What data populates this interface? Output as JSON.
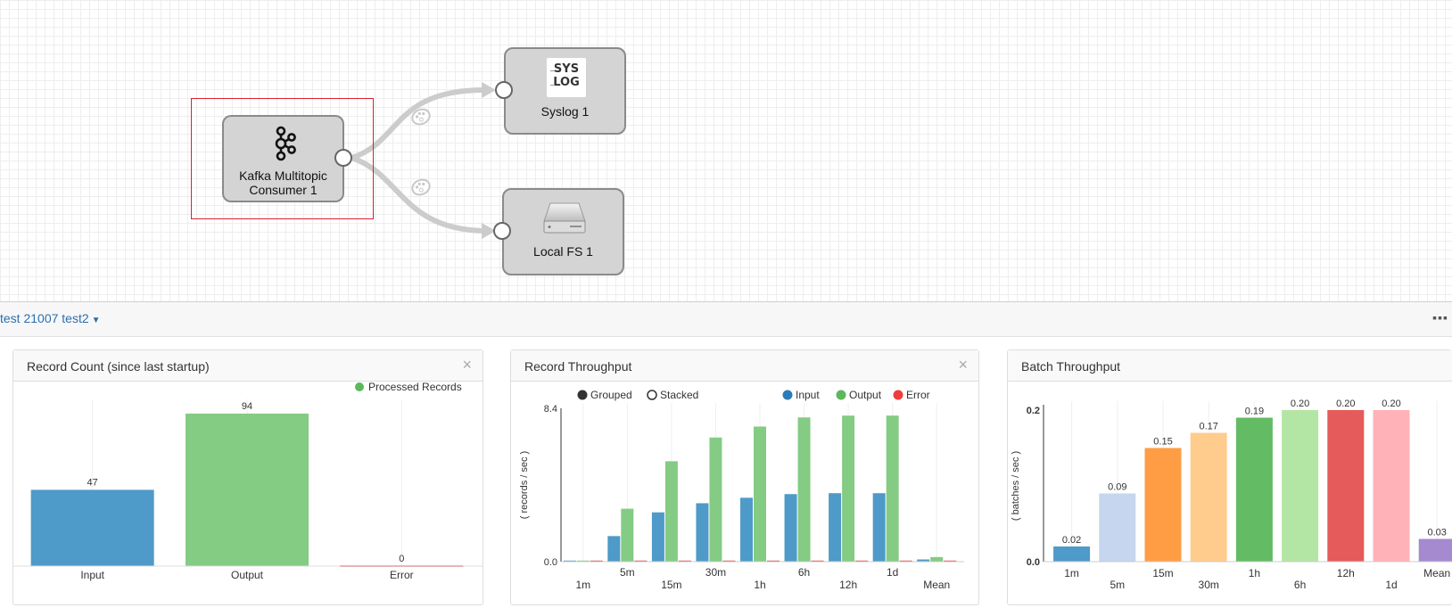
{
  "canvas": {
    "stages": [
      {
        "id": "kafka",
        "label_line1": "Kafka Multitopic",
        "label_line2": "Consumer 1",
        "icon": "kafka-icon"
      },
      {
        "id": "syslog",
        "label_line1": "Syslog 1",
        "icon": "syslog-icon",
        "icon_text_top": "SYS",
        "icon_text_bottom": "LOG"
      },
      {
        "id": "localfs",
        "label_line1": "Local FS 1",
        "icon": "hard-drive-icon"
      }
    ],
    "edge_icon": "palette-icon",
    "selection_color": "#d9232d"
  },
  "panel_bar": {
    "pipeline_dropdown": "test 21007 test2",
    "more_icon": "ellipsis-icon",
    "more_label": "▪▪▪"
  },
  "widgets": {
    "record_count": {
      "title": "Record Count (since last startup)",
      "close_label": "×"
    },
    "record_throughput": {
      "title": "Record Throughput",
      "close_label": "×",
      "toggle_grouped": "Grouped",
      "toggle_stacked": "Stacked"
    },
    "batch_throughput": {
      "title": "Batch Throughput"
    }
  },
  "chart_data": [
    {
      "type": "bar",
      "chart": "record_count",
      "categories": [
        "Input",
        "Output",
        "Error"
      ],
      "values": [
        47,
        94,
        0
      ],
      "value_labels": [
        "47",
        "94",
        "0"
      ],
      "legend": [
        "Processed Records"
      ],
      "legend_color": "#5cb85c",
      "colors": [
        "#4e9ac8",
        "#84cb84",
        "#f28a8a"
      ],
      "ylim": [
        0,
        100
      ]
    },
    {
      "type": "bar",
      "chart": "record_throughput",
      "categories": [
        "1m",
        "5m",
        "15m",
        "30m",
        "1h",
        "6h",
        "12h",
        "1d",
        "Mean"
      ],
      "ylabel": "( records / sec )",
      "ytick_labels": [
        "8.4",
        "0.0"
      ],
      "ylim": [
        0,
        8.4
      ],
      "series": [
        {
          "name": "Input",
          "color": "#4e9ac8",
          "values": [
            0.02,
            1.4,
            2.7,
            3.2,
            3.5,
            3.7,
            3.75,
            3.75,
            0.12
          ]
        },
        {
          "name": "Output",
          "color": "#84cb84",
          "values": [
            0.03,
            2.9,
            5.5,
            6.8,
            7.4,
            7.9,
            8.0,
            8.0,
            0.25
          ]
        },
        {
          "name": "Error",
          "color": "#f03c3c",
          "values": [
            0,
            0,
            0,
            0,
            0,
            0,
            0,
            0,
            0
          ]
        }
      ],
      "legend_colors": [
        "#2b7bba",
        "#5cb85c",
        "#f03c3c"
      ]
    },
    {
      "type": "bar",
      "chart": "batch_throughput",
      "categories": [
        "1m",
        "5m",
        "15m",
        "30m",
        "1h",
        "6h",
        "12h",
        "1d",
        "Mean"
      ],
      "values": [
        0.02,
        0.09,
        0.15,
        0.17,
        0.19,
        0.2,
        0.2,
        0.2,
        0.03
      ],
      "value_labels": [
        "0.02",
        "0.09",
        "0.15",
        "0.17",
        "0.19",
        "0.20",
        "0.20",
        "0.20",
        "0.03"
      ],
      "ylabel": "( batches / sec )",
      "ytick_labels": [
        "0.2",
        "0.0"
      ],
      "ylim": [
        0,
        0.2
      ],
      "colors": [
        "#4e9ac8",
        "#c5d6ee",
        "#ff9d45",
        "#ffcc8e",
        "#63bb63",
        "#b3e6a4",
        "#e55a5a",
        "#ffb3b8",
        "#a58ad0"
      ]
    }
  ]
}
